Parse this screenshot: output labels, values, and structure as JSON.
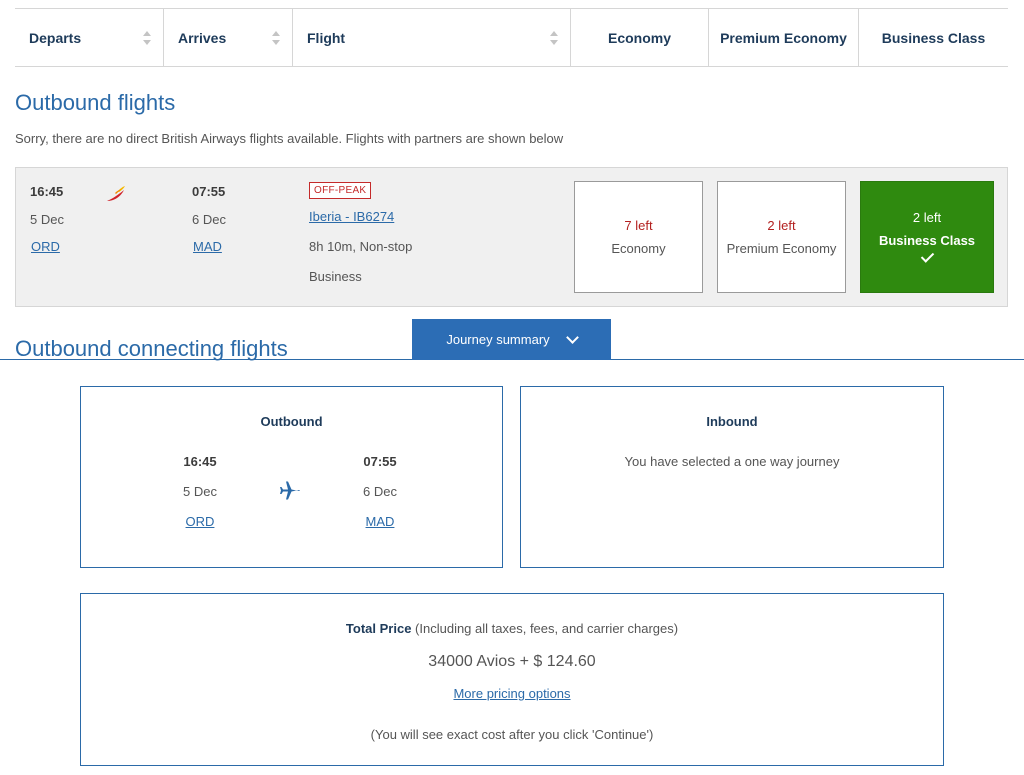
{
  "header": {
    "departs": "Departs",
    "arrives": "Arrives",
    "flight": "Flight",
    "economy": "Economy",
    "premium_economy": "Premium Economy",
    "business_class": "Business Class"
  },
  "outbound": {
    "title": "Outbound flights",
    "notice": "Sorry, there are no direct British Airways flights available. Flights with partners are shown below"
  },
  "flight": {
    "depart_time": "16:45",
    "depart_date": "5 Dec",
    "depart_code": "ORD",
    "arrive_time": "07:55",
    "arrive_date": "6 Dec",
    "arrive_code": "MAD",
    "badge": "OFF-PEAK",
    "airline": "Iberia - IB6274",
    "duration": "8h 10m, Non-stop",
    "cabin": "Business",
    "airline_logo_icon": "iberia-logo-icon",
    "fares": [
      {
        "left": "7 left",
        "name": "Economy"
      },
      {
        "left": "2 left",
        "name": "Premium Economy"
      },
      {
        "left": "2 left",
        "name": "Business Class",
        "selected": true
      }
    ]
  },
  "connecting": {
    "title": "Outbound connecting flights"
  },
  "journey_summary": {
    "button_label": "Journey summary",
    "outbound": {
      "title": "Outbound",
      "depart_time": "16:45",
      "depart_date": "5 Dec",
      "depart_code": "ORD",
      "arrive_time": "07:55",
      "arrive_date": "6 Dec",
      "arrive_code": "MAD"
    },
    "inbound": {
      "title": "Inbound",
      "text": "You have selected a one way journey"
    },
    "price": {
      "label": "Total Price",
      "note": " (Including all taxes, fees, and carrier charges)",
      "amount": "34000 Avios + $ 124.60",
      "more_link": "More pricing options",
      "disclaimer": "(You will see exact cost after you click 'Continue')"
    }
  },
  "colors": {
    "accent_blue": "#2b6aa8",
    "button_blue": "#2c6db5",
    "selected_green": "#2f8a0f",
    "seats_red": "#b3201f"
  }
}
